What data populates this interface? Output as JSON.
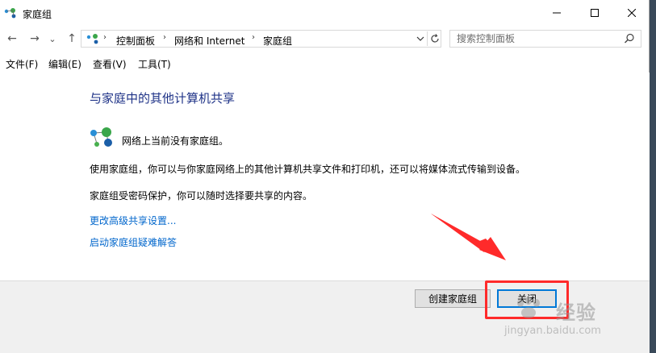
{
  "window": {
    "title": "家庭组",
    "controls": {
      "minimize": "—",
      "maximize": "☐",
      "close": "✕"
    }
  },
  "nav": {
    "back_icon": "←",
    "forward_icon": "→",
    "recent_icon": "⌄",
    "up_icon": "↑",
    "breadcrumbs": [
      "控制面板",
      "网络和 Internet",
      "家庭组"
    ],
    "separator": "›",
    "search_placeholder": "搜索控制面板"
  },
  "menu": [
    "文件(F)",
    "编辑(E)",
    "查看(V)",
    "工具(T)"
  ],
  "content": {
    "heading": "与家庭中的其他计算机共享",
    "status": "网络上当前没有家庭组。",
    "desc1": "使用家庭组，你可以与你家庭网络上的其他计算机共享文件和打印机，还可以将媒体流式传输到设备。",
    "desc2": "家庭组受密码保护，你可以随时选择要共享的内容。",
    "links": [
      "更改高级共享设置...",
      "启动家庭组疑难解答"
    ]
  },
  "footer": {
    "create_button": "创建家庭组",
    "close_button": "关闭"
  },
  "watermark": {
    "brand": "经验",
    "url": "jingyan.baidu.com"
  },
  "colors": {
    "heading": "#1e3287",
    "link": "#0066cc",
    "annotation": "#ff2a2a",
    "accent": "#0078d7"
  }
}
